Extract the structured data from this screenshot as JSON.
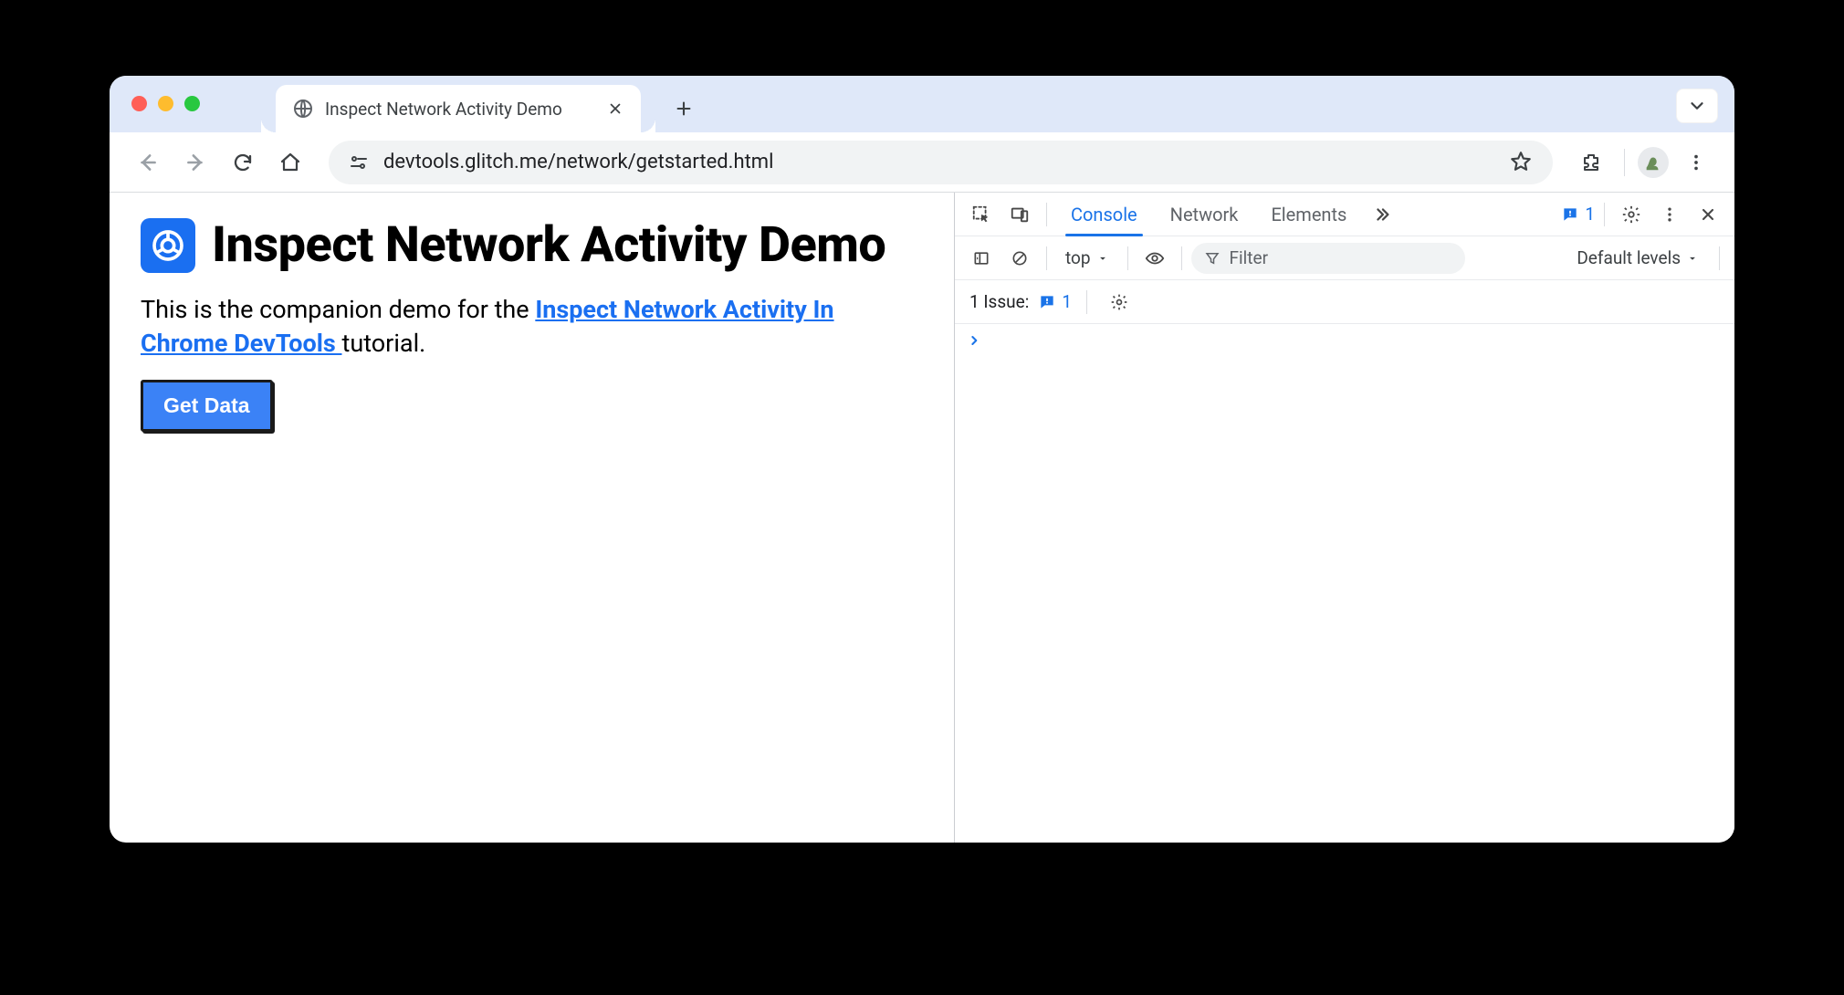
{
  "tabstrip": {
    "tab_title": "Inspect Network Activity Demo"
  },
  "toolbar": {
    "url": "devtools.glitch.me/network/getstarted.html"
  },
  "page": {
    "heading": "Inspect Network Activity Demo",
    "intro_prefix": "This is the companion demo for the ",
    "intro_link": "Inspect Network Activity In Chrome DevTools ",
    "intro_suffix": "tutorial.",
    "button": "Get Data"
  },
  "devtools": {
    "tabs": {
      "console": "Console",
      "network": "Network",
      "elements": "Elements"
    },
    "issue_count": "1",
    "context": "top",
    "filter_placeholder": "Filter",
    "levels_label": "Default levels",
    "issues_label": "1 Issue:",
    "issues_count": "1"
  }
}
